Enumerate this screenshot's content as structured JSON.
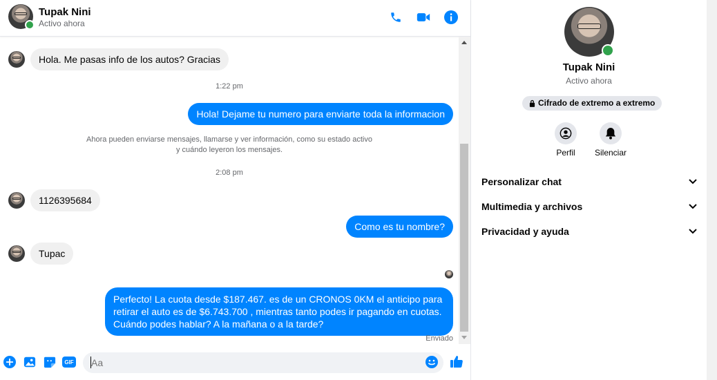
{
  "contact": {
    "name": "Tupak Nini",
    "status": "Activo ahora"
  },
  "header": {
    "icons": [
      "phone-icon",
      "video-icon",
      "info-icon"
    ]
  },
  "messages": {
    "m1": "Hola. Me pasas info de los autos? Gracias",
    "t1": "1:22 pm",
    "m2": "Hola! Dejame tu numero  para enviarte toda la informacion",
    "sys_line1": "Ahora pueden enviarse mensajes, llamarse y ver información, como su estado activo",
    "sys_line2": "y cuándo leyeron los mensajes.",
    "t2": "2:08 pm",
    "m3": "1126395684",
    "m4": "Como es tu nombre?",
    "m5": "Tupac",
    "m6": "Perfecto! La cuota desde $187.467. es de un CRONOS 0KM el anticipo para retirar el auto es de $6.743.700 , mientras tanto podes ir pagando en cuotas. Cuándo podes hablar? A la mañana o a la tarde?",
    "sent_status": "Enviado"
  },
  "composer": {
    "placeholder": "Aa",
    "icons": [
      "plus-icon",
      "image-icon",
      "sticker-icon",
      "gif-icon",
      "emoji-icon",
      "like-icon"
    ],
    "gif_label": "GIF"
  },
  "info_panel": {
    "encryption": "Cifrado de extremo a extremo",
    "actions": {
      "profile": "Perfil",
      "mute": "Silenciar"
    },
    "sections": [
      "Personalizar chat",
      "Multimedia y archivos",
      "Privacidad y ayuda"
    ]
  },
  "colors": {
    "accent": "#0084ff",
    "online": "#31a24c",
    "bubble_in": "#f0f0f0"
  }
}
